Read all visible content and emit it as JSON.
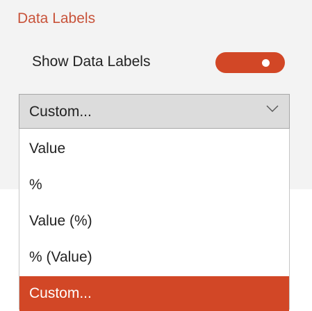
{
  "section": {
    "title": "Data Labels"
  },
  "toggle": {
    "label": "Show Data Labels",
    "state": "on"
  },
  "dropdown": {
    "selected_value": "Custom...",
    "icon": "chevron-down-icon",
    "options": [
      {
        "label": "Value",
        "selected": false
      },
      {
        "label": "%",
        "selected": false
      },
      {
        "label": "Value (%)",
        "selected": false
      },
      {
        "label": "% (Value)",
        "selected": false
      },
      {
        "label": "Custom...",
        "selected": true
      }
    ]
  },
  "colors": {
    "accent": "#d24726",
    "title_text": "#c8533a",
    "panel_background": "#f3f3f3",
    "dropdown_background": "#dcdcdc"
  }
}
